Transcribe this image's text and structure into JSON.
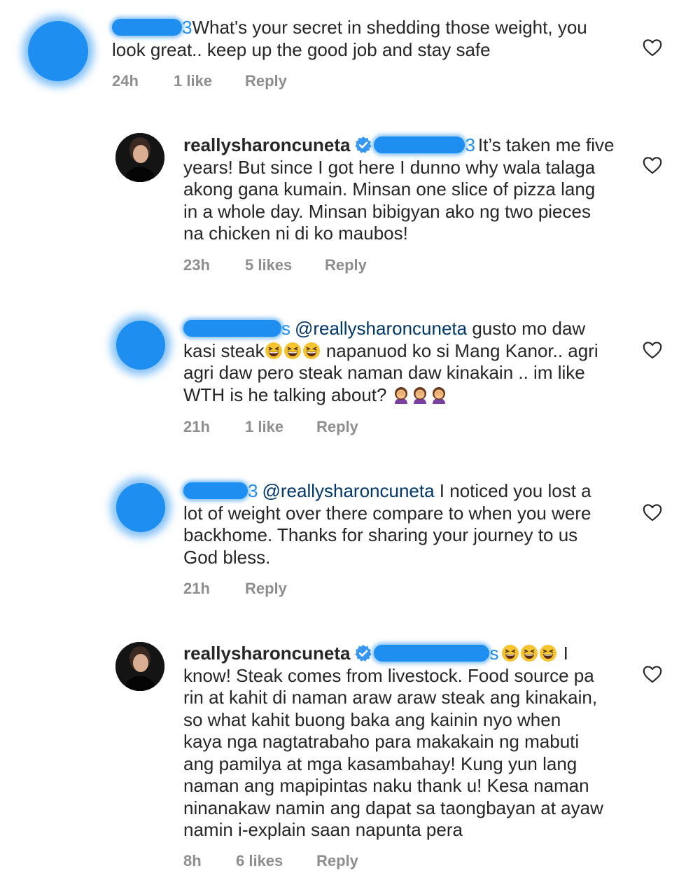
{
  "comments": [
    {
      "redacted_suffix": "3",
      "text": "What's your secret in shedding those weight, you look great.. keep up the good job and stay safe",
      "line1": "What's your secret in shedding those weight, you",
      "line2": "look great.. keep up the good job and stay safe",
      "time": "24h",
      "likes": "1 like",
      "reply": "Reply"
    },
    {
      "username": "reallysharoncuneta",
      "redacted_suffix": "3",
      "line1": "It’s taken me five",
      "line2": "years! But since I got here I dunno why wala talaga",
      "line3": "akong gana kumain. Minsan one slice of pizza lang",
      "line4": "in a whole day. Minsan bibigyan ako ng two pieces",
      "line5": "na chicken ni di ko maubos!",
      "time": "23h",
      "likes": "5 likes",
      "reply": "Reply"
    },
    {
      "redacted_suffix": "s",
      "mention": "@reallysharoncuneta",
      "line1": "gusto mo daw",
      "line2a": "kasi steak",
      "line2b": "napanuod ko si Mang Kanor.. agri",
      "line3": "agri daw pero steak naman daw kinakain .. im like",
      "line4": "WTH is he talking about?",
      "time": "21h",
      "likes": "1 like",
      "reply": "Reply"
    },
    {
      "redacted_suffix": "3",
      "mention": "@reallysharoncuneta",
      "line1": "I noticed you lost a",
      "line2": "lot of weight over there compare to when you were",
      "line3": "backhome. Thanks for sharing your journey to us",
      "line4": "God bless.",
      "time": "21h",
      "reply": "Reply"
    },
    {
      "username": "reallysharoncuneta",
      "redacted_suffix": "s",
      "line1": "I",
      "line2": "know! Steak comes from livestock. Food source pa",
      "line3": "rin at kahit di naman araw araw steak ang kinakain,",
      "line4": "so what kahit buong baka ang kainin nyo when",
      "line5": "kaya nga nagtatrabaho para makakain ng mabuti",
      "line6": "ang pamilya at mga kasambahay! Kung yun lang",
      "line7": "naman ang mapipintas naku thank u! Kesa naman",
      "line8": "ninanakaw namin ang dapat sa taongbayan at ayaw",
      "line9": "namin i-explain saan napunta pera",
      "time": "8h",
      "likes": "6 likes",
      "reply": "Reply"
    }
  ],
  "icons": {
    "like": "heart-outline-icon",
    "verified": "verified-badge-icon",
    "laughing": "grinning-squinting-face-emoji",
    "facepalm": "woman-facepalming-emoji"
  },
  "colors": {
    "text": "#262626",
    "meta": "#8e8e8e",
    "mention": "#00376b",
    "verified": "#3897f0",
    "redaction": "#1e8ef0"
  }
}
